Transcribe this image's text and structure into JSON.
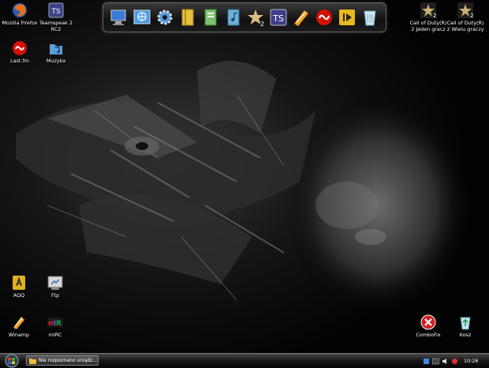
{
  "desktop": {
    "icons": [
      {
        "label": "Mozilla Firefox",
        "icon": "firefox-icon"
      },
      {
        "label": "Teamspeak 2\nRC2",
        "icon": "teamspeak-icon"
      },
      {
        "label": "Last.fm",
        "icon": "lastfm-icon"
      },
      {
        "label": "Muzyka",
        "icon": "music-folder-icon"
      },
      {
        "label": "Call of Duty(R)\n2 Jeden gracz",
        "icon": "call-of-duty-icon"
      },
      {
        "label": "Call of Duty(R)\n2 Wielu graczy",
        "icon": "call-of-duty-icon"
      },
      {
        "label": "AQQ",
        "icon": "aqq-icon"
      },
      {
        "label": "Ftp",
        "icon": "ftp-icon"
      },
      {
        "label": "Winamp",
        "icon": "winamp-icon"
      },
      {
        "label": "mIRC",
        "icon": "mirc-icon"
      },
      {
        "label": "ComboFix",
        "icon": "combofix-icon"
      },
      {
        "label": "Kosz",
        "icon": "recycle-bin-icon"
      }
    ]
  },
  "dock": {
    "items": [
      "my-computer-icon",
      "internet-icon",
      "settings-gear-icon",
      "folder-icon",
      "documents-folder-icon",
      "music-folder-icon",
      "call-of-duty-icon",
      "teamspeak-icon",
      "winamp-icon",
      "lastfm-icon",
      "media-player-icon",
      "recycle-bin-icon"
    ]
  },
  "taskbar": {
    "task_label": "Nie rozpoznano urządz...",
    "clock": "10:26"
  }
}
